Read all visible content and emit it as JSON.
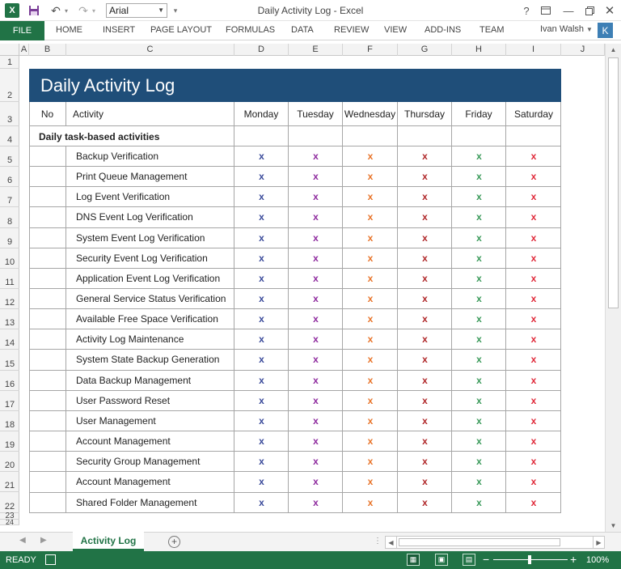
{
  "titlebar": {
    "window_title": "Daily Activity Log - Excel",
    "font_name": "Arial",
    "app_icon_text": "X"
  },
  "ribbon": {
    "file_label": "FILE",
    "tabs": [
      "HOME",
      "INSERT",
      "PAGE LAYOUT",
      "FORMULAS",
      "DATA",
      "REVIEW",
      "VIEW",
      "ADD-INS",
      "TEAM"
    ],
    "user_name": "Ivan Walsh",
    "user_initial": "K"
  },
  "columns": [
    "A",
    "B",
    "C",
    "D",
    "E",
    "F",
    "G",
    "H",
    "I",
    "J"
  ],
  "rows": [
    "1",
    "2",
    "3",
    "4",
    "5",
    "6",
    "7",
    "8",
    "9",
    "10",
    "11",
    "12",
    "13",
    "14",
    "15",
    "16",
    "17",
    "18",
    "19",
    "20",
    "21",
    "22",
    "23",
    "24"
  ],
  "report": {
    "title": "Daily Activity Log",
    "headers": {
      "no": "No",
      "activity": "Activity",
      "days": [
        "Monday",
        "Tuesday",
        "Wednesday",
        "Thursday",
        "Friday",
        "Saturday"
      ]
    },
    "section_label": "Daily task-based activities",
    "mark": "x",
    "day_colors": [
      "#3a4a9a",
      "#8e2a9e",
      "#e8742a",
      "#b0282a",
      "#3a9a5a",
      "#e02a3a"
    ],
    "activities": [
      "Backup Verification",
      "Print Queue Management",
      "Log Event Verification",
      "DNS Event Log Verification",
      "System Event Log Verification",
      "Security Event Log Verification",
      "Application Event Log Verification",
      "General Service Status Verification",
      "Available Free Space Verification",
      "Activity Log Maintenance",
      "System State Backup Generation",
      "Data Backup Management",
      "User Password Reset",
      "User Management",
      "Account Management",
      "Security Group Management",
      "Account Management",
      "Shared Folder Management"
    ]
  },
  "sheet_tabs": {
    "active": "Activity Log",
    "add_symbol": "+"
  },
  "statusbar": {
    "ready": "READY",
    "zoom": "100%"
  }
}
